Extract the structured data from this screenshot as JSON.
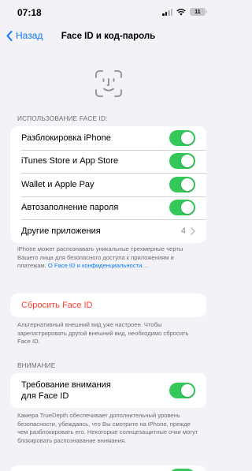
{
  "status_bar": {
    "time": "07:18",
    "battery": "11",
    "icons": [
      "cellular-signal-icon",
      "wifi-icon",
      "battery-icon"
    ]
  },
  "nav": {
    "back_label": "Назад",
    "title": "Face ID и код-пароль"
  },
  "usage": {
    "header": "ИСПОЛЬЗОВАНИЕ FACE ID:",
    "items": [
      {
        "label": "Разблокировка iPhone",
        "on": true
      },
      {
        "label": "iTunes Store и App Store",
        "on": true
      },
      {
        "label": "Wallet и Apple Pay",
        "on": true
      },
      {
        "label": "Автозаполнение пароля",
        "on": true
      }
    ],
    "other_apps": {
      "label": "Другие приложения",
      "value": "4"
    },
    "footer_text": "iPhone может распознавать уникальные трехмерные черты Вашего лица для безопасного доступа к приложениям и платежам.",
    "footer_link": "О Face ID и конфиденциальности…"
  },
  "reset": {
    "label": "Сбросить Face ID",
    "footer": "Альтернативный внешний вид уже настроен. Чтобы зарегистрировать другой внешний вид, необходимо сбросить Face ID."
  },
  "attention": {
    "header": "ВНИМАНИЕ",
    "label_line1": "Требование внимания",
    "label_line2": "для Face ID",
    "on": true,
    "footer": "Камера TrueDepth обеспечивает дополнительный уровень безопасности, убеждаясь, что Вы смотрите на iPhone, прежде чем разблокировать его. Некоторые солнцезащитные очки могут блокировать распознавание внимания."
  },
  "colors": {
    "accent": "#0a7aff",
    "toggle_on": "#34c759",
    "destructive": "#ff3b30",
    "background": "#f2f2f7"
  }
}
